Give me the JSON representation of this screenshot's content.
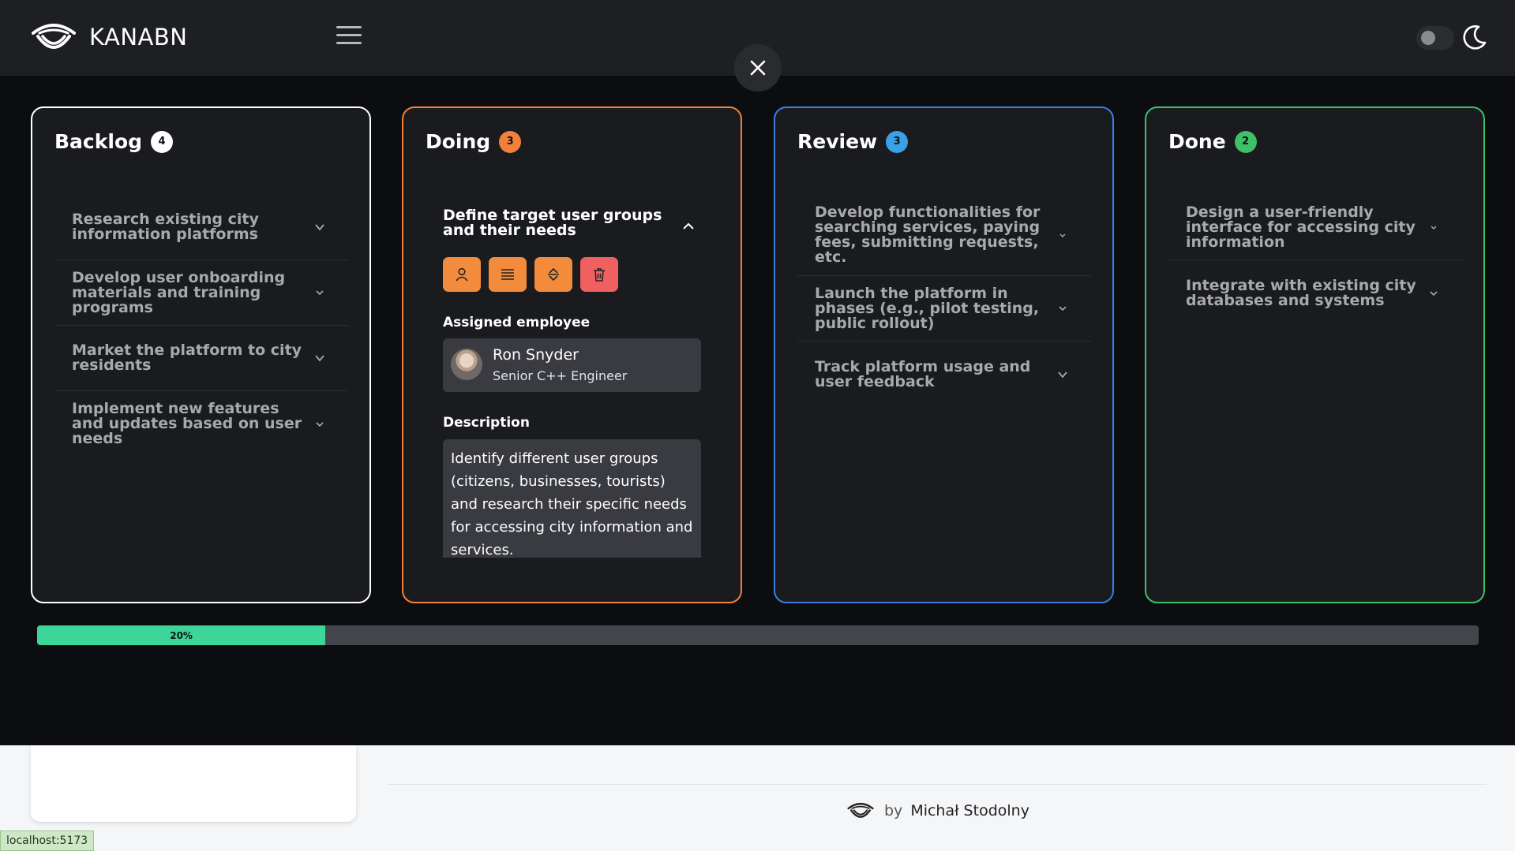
{
  "app": {
    "name": "KANABN"
  },
  "columns": {
    "backlog": {
      "title": "Backlog",
      "count": "4",
      "tasks": [
        {
          "title": "Research existing city information platforms"
        },
        {
          "title": "Develop user onboarding materials and training programs"
        },
        {
          "title": "Market the platform to city residents"
        },
        {
          "title": "Implement new features and updates based on user needs"
        }
      ]
    },
    "doing": {
      "title": "Doing",
      "count": "3",
      "expanded_task": {
        "title": "Define target user groups and their needs",
        "assigned_label": "Assigned employee",
        "employee_name": "Ron Snyder",
        "employee_role": "Senior C++ Engineer",
        "description_label": "Description",
        "description": "Identify different user groups (citizens, businesses, tourists) and research their specific needs for accessing city information and services."
      }
    },
    "review": {
      "title": "Review",
      "count": "3",
      "tasks": [
        {
          "title": "Develop functionalities for searching services, paying fees, submitting requests, etc."
        },
        {
          "title": "Launch the platform in phases (e.g., pilot testing, public rollout)"
        },
        {
          "title": "Track platform usage and user feedback"
        }
      ]
    },
    "done": {
      "title": "Done",
      "count": "2",
      "tasks": [
        {
          "title": "Design a user-friendly interface for accessing city information"
        },
        {
          "title": "Integrate with existing city databases and systems"
        }
      ]
    }
  },
  "progress": {
    "value": 20,
    "label": "20%"
  },
  "footer": {
    "by": "by",
    "author": "Michał Stodolny"
  },
  "status_bar": {
    "url": "localhost:5173"
  },
  "colors": {
    "doing": "#f0803c",
    "review": "#3b7ee0",
    "done": "#3dc06a",
    "progress": "#3dd598",
    "action": "#f28c3c",
    "danger": "#f06060"
  }
}
